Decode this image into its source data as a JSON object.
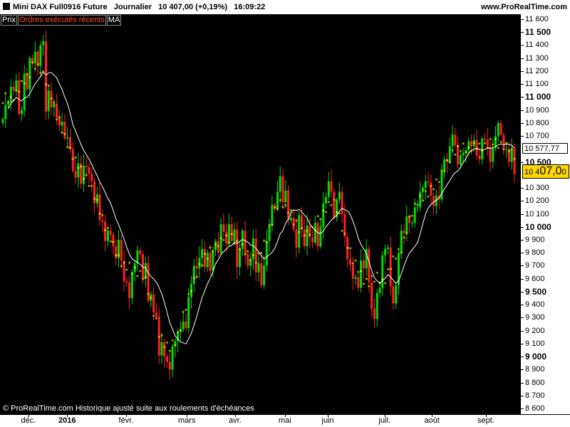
{
  "header": {
    "title": "Mini DAX Full0916 Future   Journalier   10 407,00 (+0,19%)   16:09:22",
    "site": "www.ProRealTime.com"
  },
  "legend": {
    "prix": "Prix",
    "ordres": "Ordres exécutés récents",
    "ma": "MA"
  },
  "footnote": "© ProRealTime.com Historique ajusté suite aux roulements d'échéances",
  "colors": {
    "up": "#00dd00",
    "down": "#ff2020",
    "ma_line": "#ffffff",
    "sar": "#ffff00",
    "background": "#000000",
    "price_box": "#ffd800"
  },
  "price_box": {
    "prefix": "10 4",
    "big": "07,0",
    "suffix": "0"
  },
  "ma_box": "10 577,77",
  "y_axis": {
    "min": 8590,
    "max": 11630,
    "ticks": [
      {
        "value": 11600,
        "label": "11 600",
        "major": false
      },
      {
        "value": 11500,
        "label": "11 500",
        "major": true
      },
      {
        "value": 11400,
        "label": "11 400",
        "major": false
      },
      {
        "value": 11300,
        "label": "11 300",
        "major": false
      },
      {
        "value": 11200,
        "label": "11 200",
        "major": false
      },
      {
        "value": 11100,
        "label": "11 100",
        "major": false
      },
      {
        "value": 11000,
        "label": "11 000",
        "major": true
      },
      {
        "value": 10900,
        "label": "10 900",
        "major": false
      },
      {
        "value": 10800,
        "label": "10 800",
        "major": false
      },
      {
        "value": 10700,
        "label": "10 700",
        "major": false
      },
      {
        "value": 10500,
        "label": "10 500",
        "major": true
      },
      {
        "value": 10300,
        "label": "10 300",
        "major": false
      },
      {
        "value": 10200,
        "label": "10 200",
        "major": false
      },
      {
        "value": 10100,
        "label": "10 100",
        "major": false
      },
      {
        "value": 10000,
        "label": "10 000",
        "major": true
      },
      {
        "value": 9900,
        "label": "9 900",
        "major": false
      },
      {
        "value": 9800,
        "label": "9 800",
        "major": false
      },
      {
        "value": 9700,
        "label": "9 700",
        "major": false
      },
      {
        "value": 9600,
        "label": "9 600",
        "major": false
      },
      {
        "value": 9500,
        "label": "9 500",
        "major": true
      },
      {
        "value": 9400,
        "label": "9 400",
        "major": false
      },
      {
        "value": 9300,
        "label": "9 300",
        "major": false
      },
      {
        "value": 9200,
        "label": "9 200",
        "major": false
      },
      {
        "value": 9100,
        "label": "9 100",
        "major": false
      },
      {
        "value": 9000,
        "label": "9 000",
        "major": true
      },
      {
        "value": 8900,
        "label": "8 900",
        "major": false
      },
      {
        "value": 8800,
        "label": "8 800",
        "major": false
      },
      {
        "value": 8700,
        "label": "8 700",
        "major": false
      },
      {
        "value": 8600,
        "label": "8 600",
        "major": false
      }
    ]
  },
  "x_axis": {
    "ticks": [
      {
        "label": "déc.",
        "major": false
      },
      {
        "label": "2016",
        "major": true
      },
      {
        "label": "févr.",
        "major": false
      },
      {
        "label": "mars",
        "major": false
      },
      {
        "label": "avr.",
        "major": false
      },
      {
        "label": "mai",
        "major": false
      },
      {
        "label": "juin",
        "major": false
      },
      {
        "label": "juil.",
        "major": false
      },
      {
        "label": "août",
        "major": false
      },
      {
        "label": "sept.",
        "major": false
      }
    ]
  },
  "chart_data": {
    "type": "candlestick",
    "title": "Mini DAX Full0916 Future",
    "last_price": "10 407,00",
    "change": "+0,19%",
    "time": "16:09:22",
    "series": [
      {
        "name": "Prix",
        "type": "candles",
        "close": [
          10830,
          10940,
          10960,
          11080,
          11050,
          11130,
          10870,
          10900,
          11180,
          11060,
          11300,
          11260,
          11350,
          11240,
          11400,
          11430,
          10890,
          11050,
          10920,
          10950,
          10840,
          10780,
          10810,
          10680,
          10690,
          10600,
          10430,
          10380,
          10490,
          10330,
          10470,
          10460,
          10410,
          10350,
          10180,
          10250,
          10050,
          10040,
          9890,
          9970,
          9940,
          9850,
          9760,
          9900,
          9740,
          9580,
          9570,
          9450,
          9650,
          9720,
          9820,
          9790,
          9600,
          9720,
          9430,
          9480,
          9340,
          9310,
          9010,
          9110,
          9000,
          8960,
          8900,
          9080,
          9120,
          9190,
          9210,
          9270,
          9220,
          9460,
          9560,
          9700,
          9680,
          9760,
          9830,
          9690,
          9800,
          9660,
          9820,
          9890,
          9800,
          10020,
          9960,
          9870,
          10020,
          9890,
          9980,
          9690,
          9830,
          9970,
          9790,
          9700,
          9750,
          9910,
          9650,
          9720,
          9550,
          9700,
          9890,
          10010,
          10170,
          10140,
          10270,
          10390,
          10190,
          10280,
          10050,
          10070,
          9980,
          9840,
          10090,
          9980,
          9850,
          10010,
          9920,
          9880,
          10030,
          9850,
          10000,
          10180,
          10230,
          10350,
          10270,
          10070,
          10210,
          10270,
          10100,
          9920,
          9750,
          9710,
          9600,
          9610,
          9530,
          9740,
          9680,
          9830,
          9570,
          9370,
          9290,
          9490,
          9530,
          9780,
          9830,
          9840,
          9540,
          9410,
          9550,
          9800,
          9970,
          9950,
          10080,
          10030,
          10030,
          10150,
          10150,
          10270,
          10300,
          10350,
          10340,
          10240,
          10160,
          10240,
          10210,
          10430,
          10520,
          10500,
          10620,
          10710,
          10630,
          10480,
          10550,
          10570,
          10590,
          10660,
          10620,
          10670,
          10550,
          10520,
          10680,
          10670,
          10620,
          10500,
          10610,
          10700,
          10800,
          10710,
          10600,
          10600,
          10500,
          10600,
          10407
        ]
      },
      {
        "name": "SAR",
        "type": "dots"
      },
      {
        "name": "MA",
        "type": "line"
      }
    ],
    "y_range": [
      8600,
      11630
    ],
    "x_labels": [
      "déc.",
      "2016",
      "févr.",
      "mars",
      "avr.",
      "mai",
      "juin",
      "juil.",
      "août",
      "sept."
    ]
  }
}
